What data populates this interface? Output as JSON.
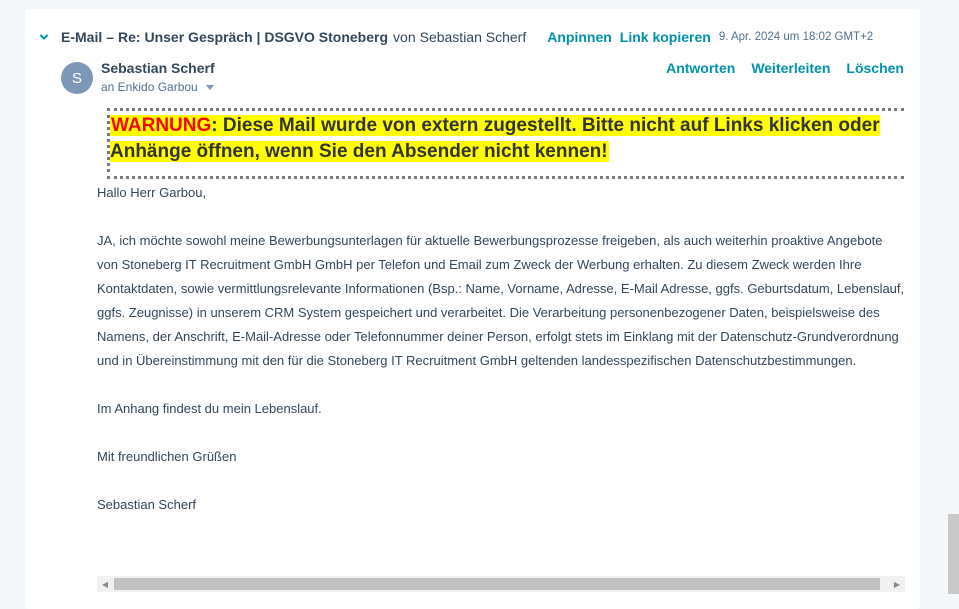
{
  "email": {
    "type_label": "E-Mail",
    "separator": "–",
    "subject": "Re: Unser Gespräch | DSGVO Stoneberg",
    "from_prefix": "von",
    "from_name": "Sebastian Scherf",
    "pin_label": "Anpinnen",
    "copy_link_label": "Link kopieren",
    "date": "9. Apr. 2024 um 18:02 GMT+2"
  },
  "sender": {
    "avatar_initial": "S",
    "name": "Sebastian Scherf",
    "recipient": "an Enkido Garbou"
  },
  "actions": {
    "reply": "Antworten",
    "forward": "Weiterleiten",
    "delete": "Löschen"
  },
  "warning": {
    "strong": "WARNUNG",
    "text": ": Diese Mail wurde von extern zugestellt. Bitte nicht auf Links klicken oder Anhänge öffnen, wenn Sie den Absender nicht kennen!"
  },
  "body": {
    "greeting": "Hallo Herr Garbou,",
    "paragraph1": "JA, ich möchte sowohl meine Bewerbungsunterlagen für aktuelle Bewerbungsprozesse freigeben, als auch weiterhin proaktive Angebote von Stoneberg IT Recruitment GmbH GmbH per Telefon und Email zum Zweck der Werbung erhalten. Zu diesem Zweck werden Ihre Kontaktdaten, sowie vermittlungsrelevante Informationen (Bsp.: Name, Vorname, Adresse, E-Mail Adresse, ggfs. Geburtsdatum, Lebenslauf, ggfs. Zeugnisse) in unserem CRM System gespeichert und verarbeitet. Die Verarbeitung personenbezogener Daten, beispielsweise des Namens, der Anschrift, E-Mail-Adresse oder Telefonnummer deiner Person, erfolgt stets im Einklang mit der Datenschutz-Grundverordnung und in Übereinstimmung mit den für die Stoneberg IT Recruitment GmbH geltenden landesspezifischen Datenschutzbestimmungen.",
    "paragraph2": "Im Anhang findest du mein Lebenslauf.",
    "closing": "Mit freundlichen Grüßen",
    "signature": "Sebastian Scherf"
  },
  "colors": {
    "link": "#0091ae",
    "warning_highlight": "#ffff00",
    "warning_red": "#ff0000"
  }
}
